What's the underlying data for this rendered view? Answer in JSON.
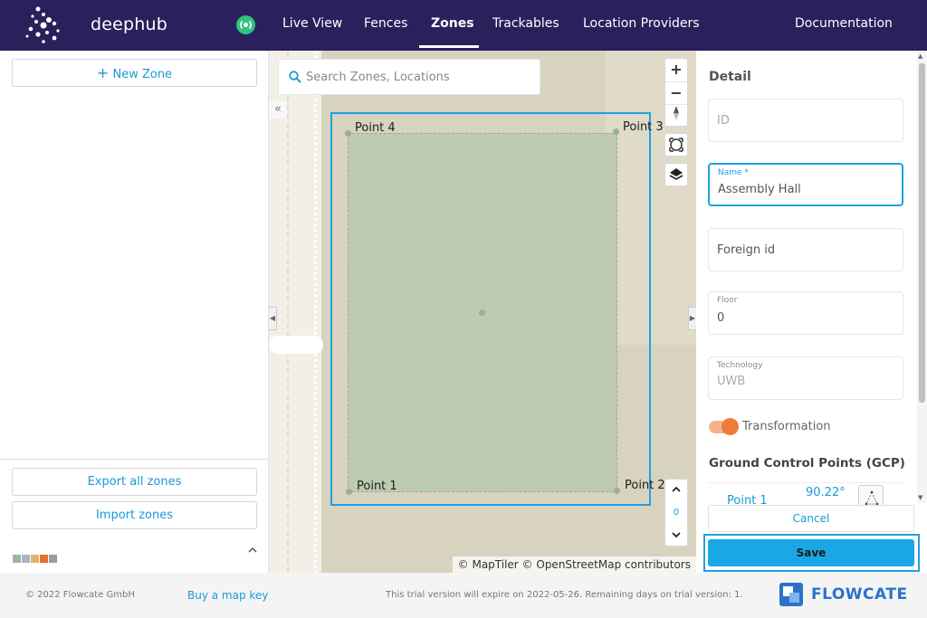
{
  "app": {
    "logo_text": "deephub",
    "nav": {
      "live_view": "Live View",
      "fences": "Fences",
      "zones": "Zones",
      "trackables": "Trackables",
      "location_providers": "Location Providers",
      "documentation": "Documentation"
    },
    "active_tab": "Zones",
    "colors": {
      "nav_bg": "#2b1f5c",
      "accent": "#1ea1e0",
      "live_indicator": "#2ec27e",
      "toggle": "#ee7b3a"
    }
  },
  "left_panel": {
    "new_zone_label": "New Zone",
    "export_label": "Export all zones",
    "import_label": "Import zones",
    "swatches": [
      "#9fb3a9",
      "#a7b4c9",
      "#e2b36b",
      "#e0732c",
      "#9d9d9d"
    ]
  },
  "map": {
    "search_placeholder": "Search Zones, Locations",
    "points": {
      "p1": "Point 1",
      "p2": "Point 2",
      "p3": "Point 3",
      "p4": "Point 4"
    },
    "tilt_value": "0",
    "attribution": "© MapTiler © OpenStreetMap contributors"
  },
  "detail": {
    "title": "Detail",
    "id": {
      "placeholder": "ID"
    },
    "name": {
      "label": "Name *",
      "value": "Assembly Hall"
    },
    "foreign_id": {
      "placeholder": "Foreign id"
    },
    "floor": {
      "label": "Floor",
      "value": "0"
    },
    "technology": {
      "label": "Technology",
      "value": "UWB"
    },
    "transformation_label": "Transformation",
    "gcp_title": "Ground Control Points (GCP)",
    "gcp_row": {
      "name": "Point 1",
      "value": "90.22°"
    },
    "cancel_label": "Cancel",
    "save_label": "Save"
  },
  "footer": {
    "copyright": "© 2022 Flowcate GmbH",
    "buy_link": "Buy a map key",
    "trial_notice": "This trial version will expire on 2022-05-26. Remaining days on trial version: 1.",
    "brand": "FLOWCATE"
  }
}
